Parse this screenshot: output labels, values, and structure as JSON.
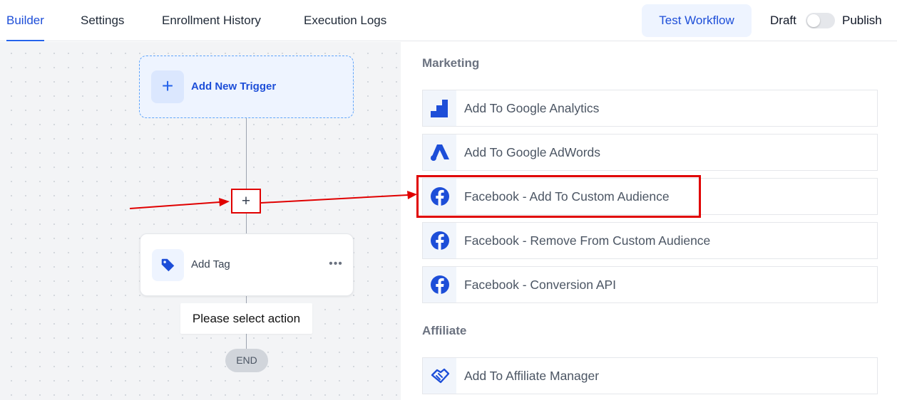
{
  "nav": {
    "tabs": [
      {
        "label": "Builder",
        "active": true
      },
      {
        "label": "Settings",
        "active": false
      },
      {
        "label": "Enrollment History",
        "active": false
      },
      {
        "label": "Execution Logs",
        "active": false
      }
    ],
    "test_button": "Test Workflow",
    "draft_label": "Draft",
    "publish_label": "Publish",
    "publish_toggle_on": false
  },
  "canvas": {
    "trigger_label": "Add New Trigger",
    "add_action_symbol": "+",
    "tag_action_label": "Add Tag",
    "more_symbol": "•••",
    "tooltip": "Please select action",
    "end_label": "END"
  },
  "panel": {
    "sections": [
      {
        "title": "Marketing",
        "items": [
          {
            "label": "Add To Google Analytics",
            "icon": "google-analytics-icon"
          },
          {
            "label": "Add To Google AdWords",
            "icon": "google-ads-icon"
          },
          {
            "label": "Facebook - Add To Custom Audience",
            "icon": "facebook-icon"
          },
          {
            "label": "Facebook - Remove From Custom Audience",
            "icon": "facebook-icon"
          },
          {
            "label": "Facebook - Conversion API",
            "icon": "facebook-icon"
          }
        ]
      },
      {
        "title": "Affiliate",
        "items": [
          {
            "label": "Add To Affiliate Manager",
            "icon": "handshake-icon"
          }
        ]
      }
    ]
  },
  "colors": {
    "accent": "#2563eb",
    "annotation_red": "#e00000",
    "facebook_blue": "#1877f2"
  }
}
